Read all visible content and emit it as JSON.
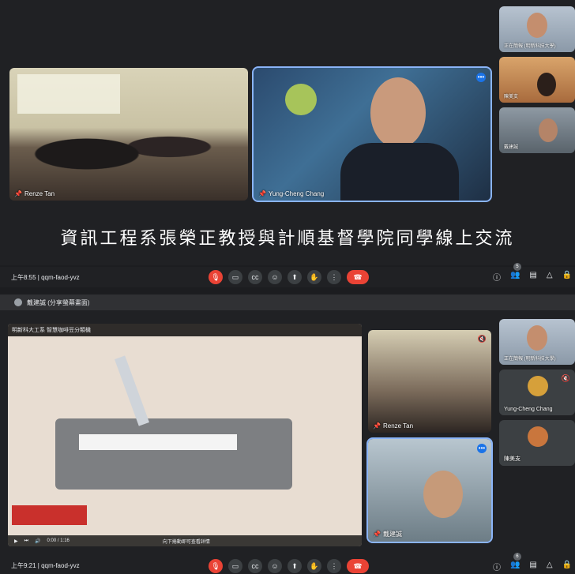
{
  "top": {
    "tiles": {
      "classroom_name": "Renze Tan",
      "speaker_name": "Yung-Cheng Chang",
      "side1_name": "正在簡報 (明新科技大學)",
      "side2_name": "陳美支",
      "side3_name": "戴建誠"
    },
    "caption": "資訊工程系張榮正教授與計順基督學院同學線上交流",
    "bar": {
      "time": "上午8:55",
      "code": "qqm-faod-yvz",
      "participants": "5"
    }
  },
  "presenting_bar": {
    "label": "戴建誠 (分享螢幕畫面)"
  },
  "video": {
    "title": "明新科大工系 智慧咖啡豆分類機",
    "time": "0:00 / 1:16",
    "hint": "向下捲動即可查看詳情"
  },
  "bottom": {
    "tiles": {
      "classroom_name": "Renze Tan",
      "self_name": "戴建誠",
      "side1_name": "正在簡報 (明新科技大學)",
      "side2_name": "Yung-Cheng Chang",
      "side3_name": "陳美支"
    },
    "bar": {
      "time": "上午9:21",
      "code": "qqm-faod-yvz",
      "participants": "6"
    }
  },
  "colors": {
    "accent": "#8ab4f8",
    "danger": "#ea4335",
    "bar": "#202124"
  },
  "icons": [
    "mic-off-icon",
    "camera-icon",
    "captions-icon",
    "emoji-icon",
    "present-icon",
    "hand-icon",
    "more-icon",
    "end-call-icon",
    "info-icon",
    "people-icon",
    "chat-icon",
    "activities-icon",
    "lock-icon"
  ]
}
